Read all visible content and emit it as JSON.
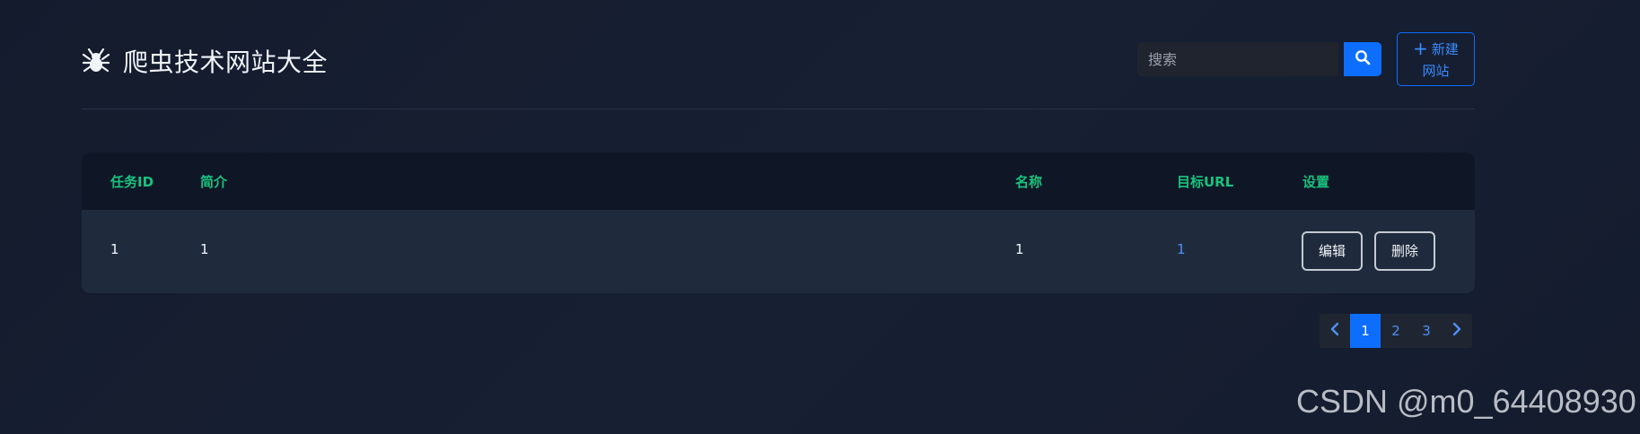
{
  "header": {
    "title": "爬虫技术网站大全",
    "logo_icon": "spider-icon"
  },
  "search": {
    "placeholder": "搜索",
    "icon": "search-icon"
  },
  "new_site_button": {
    "icon": "plus-icon",
    "label_line1": "新建",
    "label_line2": "网站",
    "color": "#0d6efd"
  },
  "table": {
    "columns": [
      "任务ID",
      "简介",
      "名称",
      "目标URL",
      "设置"
    ],
    "rows": [
      {
        "task_id": "1",
        "intro": "1",
        "name": "1",
        "target_url": "1",
        "edit_label": "编辑",
        "delete_label": "删除"
      }
    ],
    "header_color": "#19c37d"
  },
  "pagination": {
    "prev_icon": "chevron-left-icon",
    "next_icon": "chevron-right-icon",
    "pages": [
      "1",
      "2",
      "3"
    ],
    "current_page": "1"
  },
  "watermark": "CSDN @m0_64408930"
}
